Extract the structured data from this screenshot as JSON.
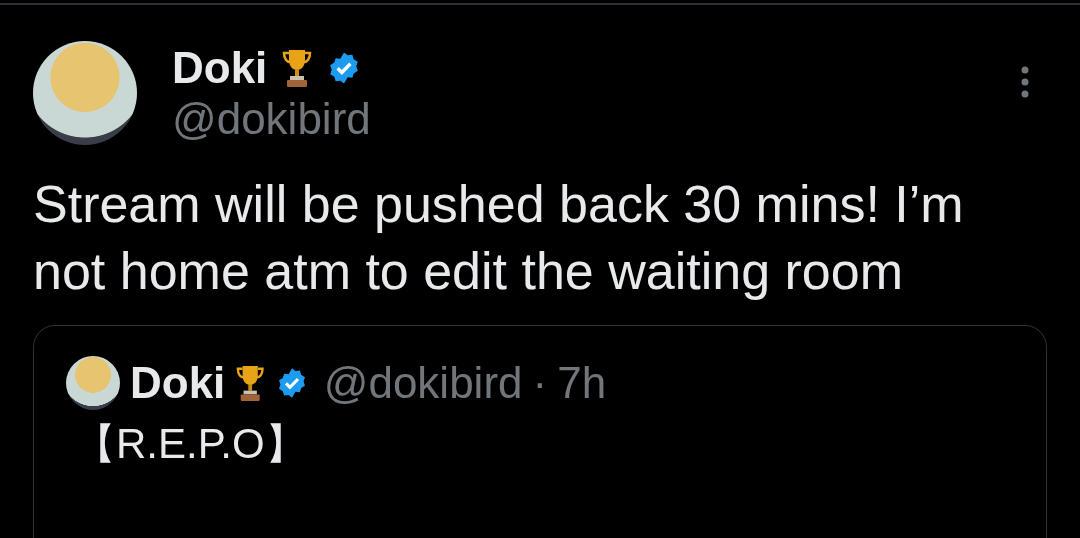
{
  "post": {
    "author": {
      "name": "Doki",
      "handle": "@dokibird",
      "verified": true
    },
    "text": "Stream will be pushed back 30 mins! I’m not home atm to edit the waiting room",
    "quoted_post": {
      "author": {
        "name": "Doki",
        "handle": "@dokibird",
        "verified": true
      },
      "separator": "·",
      "time": "7h",
      "text": "【R.E.P.O】"
    }
  }
}
